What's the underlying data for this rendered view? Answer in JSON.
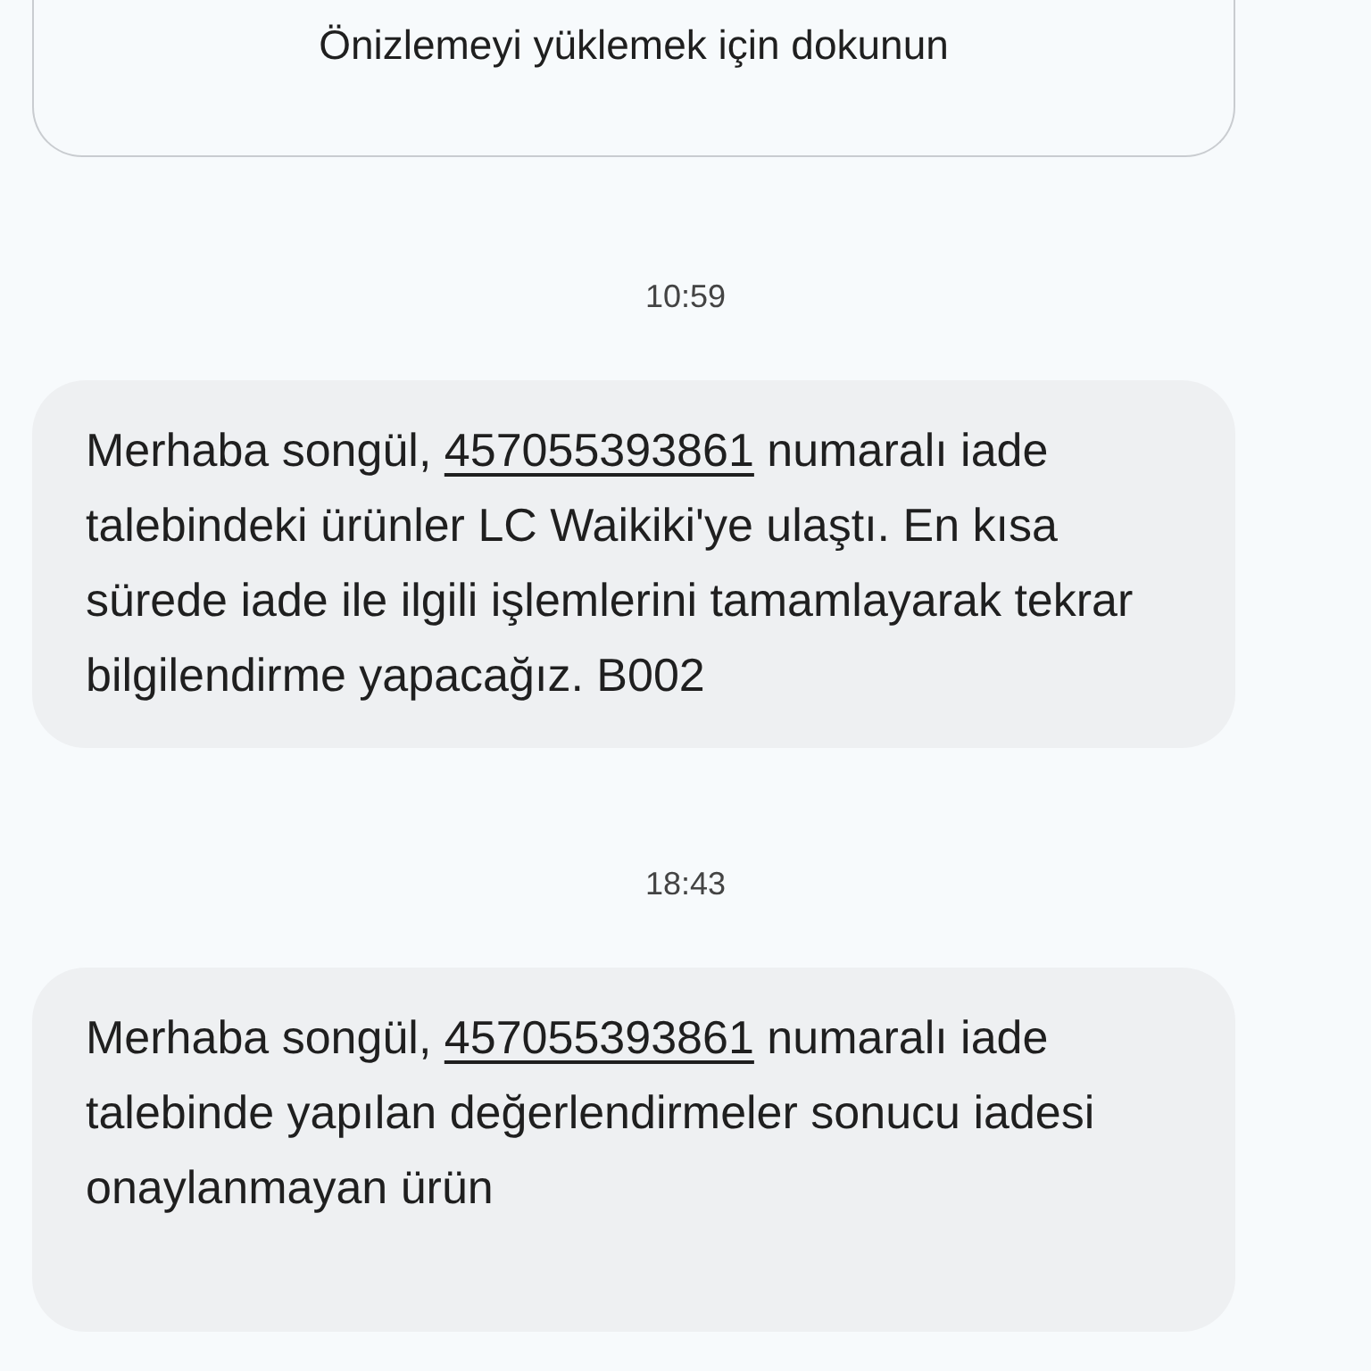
{
  "preview_card": {
    "label": "Önizlemeyi yüklemek için dokunun"
  },
  "messages": [
    {
      "time": "10:59",
      "before": "Merhaba songül, ",
      "link": "457055393861",
      "after": " numaralı iade talebindeki ürünler LC Waikiki'ye ulaştı. En kısa sürede iade ile ilgili işlemlerini tamamlayarak tekrar bilgilendirme yapacağız. B002"
    },
    {
      "time": "18:43",
      "before": "Merhaba songül, ",
      "link": "457055393861",
      "after": " numaralı iade talebinde yapılan değerlendirmeler sonucu iadesi onaylanmayan ürün"
    }
  ]
}
